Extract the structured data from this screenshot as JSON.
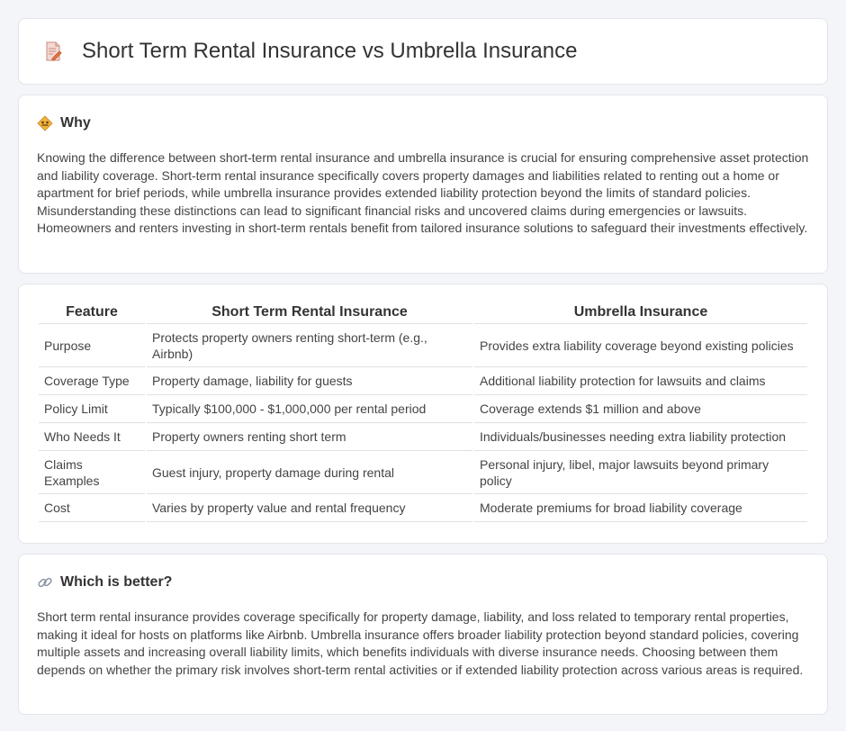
{
  "header": {
    "title": "Short Term Rental Insurance vs Umbrella Insurance",
    "icon": "document-edit-icon"
  },
  "why": {
    "title": "Why",
    "icon": "diamond-sign-icon",
    "text": "Knowing the difference between short-term rental insurance and umbrella insurance is crucial for ensuring comprehensive asset protection and liability coverage. Short-term rental insurance specifically covers property damages and liabilities related to renting out a home or apartment for brief periods, while umbrella insurance provides extended liability protection beyond the limits of standard policies. Misunderstanding these distinctions can lead to significant financial risks and uncovered claims during emergencies or lawsuits. Homeowners and renters investing in short-term rentals benefit from tailored insurance solutions to safeguard their investments effectively."
  },
  "table": {
    "headers": [
      "Feature",
      "Short Term Rental Insurance",
      "Umbrella Insurance"
    ],
    "rows": [
      [
        "Purpose",
        "Protects property owners renting short-term (e.g., Airbnb)",
        "Provides extra liability coverage beyond existing policies"
      ],
      [
        "Coverage Type",
        "Property damage, liability for guests",
        "Additional liability protection for lawsuits and claims"
      ],
      [
        "Policy Limit",
        "Typically $100,000 - $1,000,000 per rental period",
        "Coverage extends $1 million and above"
      ],
      [
        "Who Needs It",
        "Property owners renting short term",
        "Individuals/businesses needing extra liability protection"
      ],
      [
        "Claims Examples",
        "Guest injury, property damage during rental",
        "Personal injury, libel, major lawsuits beyond primary policy"
      ],
      [
        "Cost",
        "Varies by property value and rental frequency",
        "Moderate premiums for broad liability coverage"
      ]
    ]
  },
  "better": {
    "title": "Which is better?",
    "icon": "link-icon",
    "text": "Short term rental insurance provides coverage specifically for property damage, liability, and loss related to temporary rental properties, making it ideal for hosts on platforms like Airbnb. Umbrella insurance offers broader liability protection beyond standard policies, covering multiple assets and increasing overall liability limits, which benefits individuals with diverse insurance needs. Choosing between them depends on whether the primary risk involves short-term rental activities or if extended liability protection across various areas is required."
  },
  "colors": {
    "background": "#f4f5f9",
    "card": "#ffffff",
    "border": "#e3e5ea",
    "accent": "#e8743b"
  }
}
